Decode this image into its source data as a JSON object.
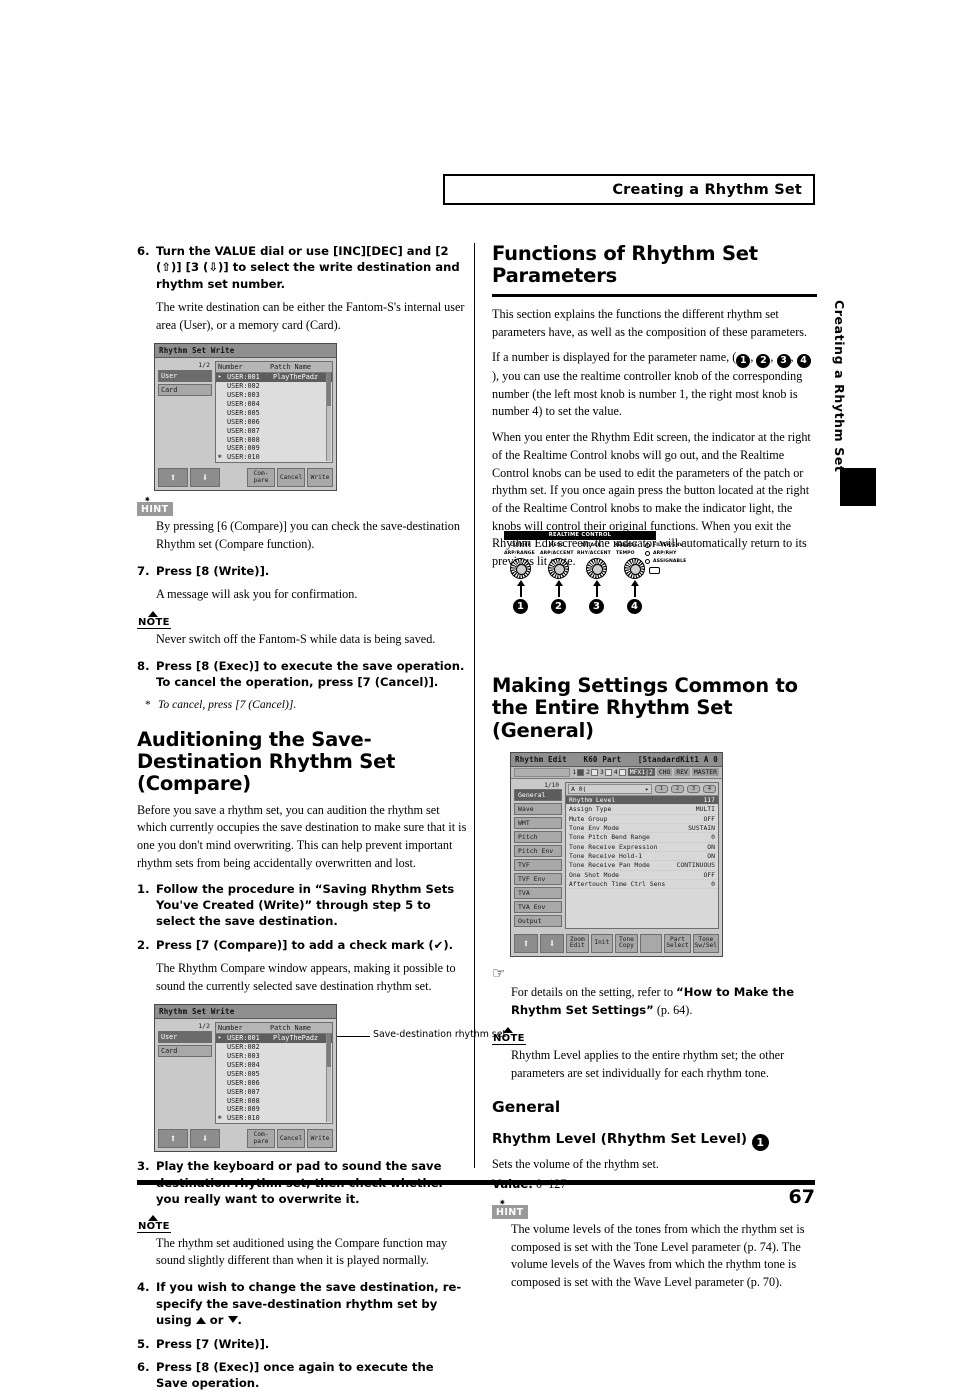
{
  "header": {
    "title": "Creating a Rhythm Set"
  },
  "side_tab": {
    "label": "Creating a Rhythm Set"
  },
  "footer": {
    "page_number": "67"
  },
  "left_column": {
    "step6": {
      "num": "6.",
      "text": "Turn the VALUE dial or use [INC][DEC] and [2 (⇧)] [3 (⇩)] to select the write destination and rhythm set number.",
      "detail": "The write destination can be either the Fantom-S's internal user area (User), or a memory card (Card)."
    },
    "figure1": {
      "title": "Rhythm Set Write",
      "page_indicator": "1/2",
      "tabs": [
        "User",
        "Card"
      ],
      "columns": [
        "Number",
        "Patch Name"
      ],
      "rows": [
        {
          "mark": "▸",
          "number": "USER:001",
          "name": "PlayThePadz",
          "selected": true
        },
        {
          "mark": "",
          "number": "USER:002",
          "name": "",
          "selected": false
        },
        {
          "mark": "",
          "number": "USER:003",
          "name": "",
          "selected": false
        },
        {
          "mark": "",
          "number": "USER:004",
          "name": "",
          "selected": false
        },
        {
          "mark": "",
          "number": "USER:005",
          "name": "",
          "selected": false
        },
        {
          "mark": "",
          "number": "USER:006",
          "name": "",
          "selected": false
        },
        {
          "mark": "",
          "number": "USER:007",
          "name": "",
          "selected": false
        },
        {
          "mark": "",
          "number": "USER:008",
          "name": "",
          "selected": false
        },
        {
          "mark": "",
          "number": "USER:009",
          "name": "",
          "selected": false
        },
        {
          "mark": "✻",
          "number": "USER:010",
          "name": "",
          "selected": false
        }
      ],
      "buttons": [
        "⬆",
        "⬇",
        "Com- pare",
        "Cancel",
        "Write"
      ]
    },
    "hint1": {
      "icon": "hint-icon",
      "label": "HINT",
      "text": "By pressing [6 (Compare)] you can check the save-destination Rhythm set (Compare function)."
    },
    "step7": {
      "num": "7.",
      "text": "Press [8 (Write)].",
      "detail": "A message will ask you for confirmation."
    },
    "note1": {
      "icon": "note-icon",
      "label": "NOTE",
      "text": "Never switch off the Fantom-S while data is being saved."
    },
    "step8": {
      "num": "8.",
      "text": "Press [8 (Exec)] to execute the save operation. To cancel the operation, press [7 (Cancel)].",
      "footnote": "To cancel, press [7 (Cancel)]."
    },
    "section_heading": "Auditioning the Save-Destination Rhythm Set (Compare)",
    "intro": "Before you save a rhythm set, you can audition the rhythm set which currently occupies the save destination to make sure that it is one you don't mind overwriting. This can help prevent important rhythm sets from being accidentally overwritten and lost.",
    "a_step1": {
      "num": "1.",
      "text": "Follow the procedure in “Saving Rhythm Sets You've Created (Write)” through step 5 to select the save destination."
    },
    "a_step2": {
      "num": "2.",
      "text": "Press [7 (Compare)] to add a check mark (✔).",
      "detail": "The Rhythm Compare window appears, making it possible to sound the currently selected save destination rhythm set."
    },
    "figure2": {
      "title": "Rhythm Set Write",
      "page_indicator": "1/2",
      "tabs": [
        "User",
        "Card"
      ],
      "columns": [
        "Number",
        "Patch Name"
      ],
      "rows": [
        {
          "mark": "▸",
          "number": "USER:001",
          "name": "PlayThePadz",
          "selected": true
        },
        {
          "mark": "",
          "number": "USER:002",
          "name": "",
          "selected": false
        },
        {
          "mark": "",
          "number": "USER:003",
          "name": "",
          "selected": false
        },
        {
          "mark": "",
          "number": "USER:004",
          "name": "",
          "selected": false
        },
        {
          "mark": "",
          "number": "USER:005",
          "name": "",
          "selected": false
        },
        {
          "mark": "",
          "number": "USER:006",
          "name": "",
          "selected": false
        },
        {
          "mark": "",
          "number": "USER:007",
          "name": "",
          "selected": false
        },
        {
          "mark": "",
          "number": "USER:008",
          "name": "",
          "selected": false
        },
        {
          "mark": "",
          "number": "USER:009",
          "name": "",
          "selected": false
        },
        {
          "mark": "✻",
          "number": "USER:010",
          "name": "",
          "selected": false
        }
      ],
      "buttons": [
        "⬆",
        "⬇",
        "Com- pare",
        "Cancel",
        "Write"
      ],
      "annotation": "Save-destination rhythm set"
    },
    "a_step3": {
      "num": "3.",
      "text": "Play the keyboard or pad to sound the save destination rhythm set, then check whether you really want to overwrite it."
    },
    "note2": {
      "icon": "note-icon",
      "label": "NOTE",
      "text": "The rhythm set auditioned using the Compare function may sound slightly different than when it is played normally."
    },
    "a_step4": {
      "num": "4.",
      "text_before": "If you wish to change the save destination, re-specify the save-destination rhythm set by using",
      "text_middle": "or",
      "text_after": "."
    },
    "a_step5": {
      "num": "5.",
      "text": "Press [7 (Write)]."
    },
    "a_step6": {
      "num": "6.",
      "text": "Press [8 (Exec)] once again to execute the Save operation."
    }
  },
  "right_column": {
    "heading": "Functions of Rhythm Set Parameters",
    "para1": "This section explains the functions the different rhythm set parameters have, as well as the composition of these parameters.",
    "para2_a": "If a number is displayed for the parameter name, (",
    "para2_nums": [
      "1",
      "2",
      "3",
      "4"
    ],
    "para2_b": "), you can use the realtime controller knob of the corresponding number (the left most knob is number 1, the right most knob is number 4) to set the value.",
    "para3": "When you enter the Rhythm Edit screen, the indicator at the right of the Realtime Control knobs will go out, and the Realtime Control knobs can be used to edit the parameters of the patch or rhythm set. If you once again press the button located at the right of the Realtime Control knobs to make the indicator light, the knobs will control their original functions. When you exit the Rhythm Edit screen, the indicator will automatically return to its previous lit state.",
    "rtc_panel": {
      "bar_label": "REALTIME CONTROL",
      "top_labels": [
        "CUTOFF",
        "RESO",
        "ATTACK",
        "RELEASE"
      ],
      "bottom_labels": [
        "ARP/RANGE",
        "ARP/ACCENT",
        "RHY/ACCENT",
        "TEMPO"
      ],
      "indicators": [
        "FILTER/ENV",
        "ARP/RHY",
        "ASSIGNABLE"
      ],
      "knob_numbers": [
        "1",
        "2",
        "3",
        "4"
      ]
    },
    "heading2": "Making Settings Common to the Entire Rhythm Set (General)",
    "figure3": {
      "title": "Rhythm Edit",
      "title_right_1": "K60 Part",
      "title_right_2": "[StandardKit1 A 0",
      "part_numbers": [
        "1",
        "2",
        "3",
        "4"
      ],
      "tags": [
        "MFX1|2",
        "CHO",
        "REV",
        "MASTER"
      ],
      "page_indicator": "1/10",
      "side_tabs": [
        "General",
        "Wave",
        "WMT",
        "Pitch",
        "Pitch Env",
        "TVF",
        "TVF Env",
        "TVA",
        "TVA Env",
        "Output"
      ],
      "selector": "A 0(",
      "knob_labels": [
        "1",
        "2",
        "3",
        "4"
      ],
      "params": [
        {
          "name": "Rhythm Level",
          "value": "117",
          "selected": true
        },
        {
          "name": "Assign Type",
          "value": "MULTI",
          "selected": false
        },
        {
          "name": "Mute Group",
          "value": "OFF",
          "selected": false
        },
        {
          "name": "Tone Env Mode",
          "value": "SUSTAIN",
          "selected": false
        },
        {
          "name": "Tone Pitch Bend Range",
          "value": "0",
          "selected": false
        },
        {
          "name": "Tone Receive Expression",
          "value": "ON",
          "selected": false
        },
        {
          "name": "Tone Receive Hold-1",
          "value": "ON",
          "selected": false
        },
        {
          "name": "Tone Receive Pan Mode",
          "value": "CONTINUOUS",
          "selected": false
        },
        {
          "name": "One Shot Mode",
          "value": "OFF",
          "selected": false
        },
        {
          "name": "Aftertouch Time Ctrl Sens",
          "value": "0",
          "selected": false
        }
      ],
      "buttons": [
        "⬆",
        "⬇",
        "Zoom Edit",
        "Init",
        "Tone Copy",
        "",
        "Part Select",
        "Tone Sw/Sel"
      ]
    },
    "ref1": {
      "icon": "pointing-hand-icon",
      "text_a": "For details on the setting, refer to ",
      "text_b": "“How to Make the Rhythm Set Settings”",
      "text_c": " (p. 64)."
    },
    "note3": {
      "icon": "note-icon",
      "label": "NOTE",
      "text": "Rhythm Level applies to the entire rhythm set; the other parameters are set individually for each rhythm tone."
    },
    "heading3": "General",
    "param_heading": "Rhythm Level (Rhythm Set Level)",
    "param_badge": "1",
    "param_desc": "Sets the volume of the rhythm set.",
    "value_label": "Value:",
    "value_range": "0–127",
    "hint2": {
      "icon": "hint-icon",
      "label": "HINT",
      "text": "The volume levels of the tones from which the rhythm set is composed is set with the Tone Level parameter (p. 74). The volume levels of the Waves from which the rhythm tone is composed is set with the Wave Level parameter (p. 70)."
    }
  }
}
